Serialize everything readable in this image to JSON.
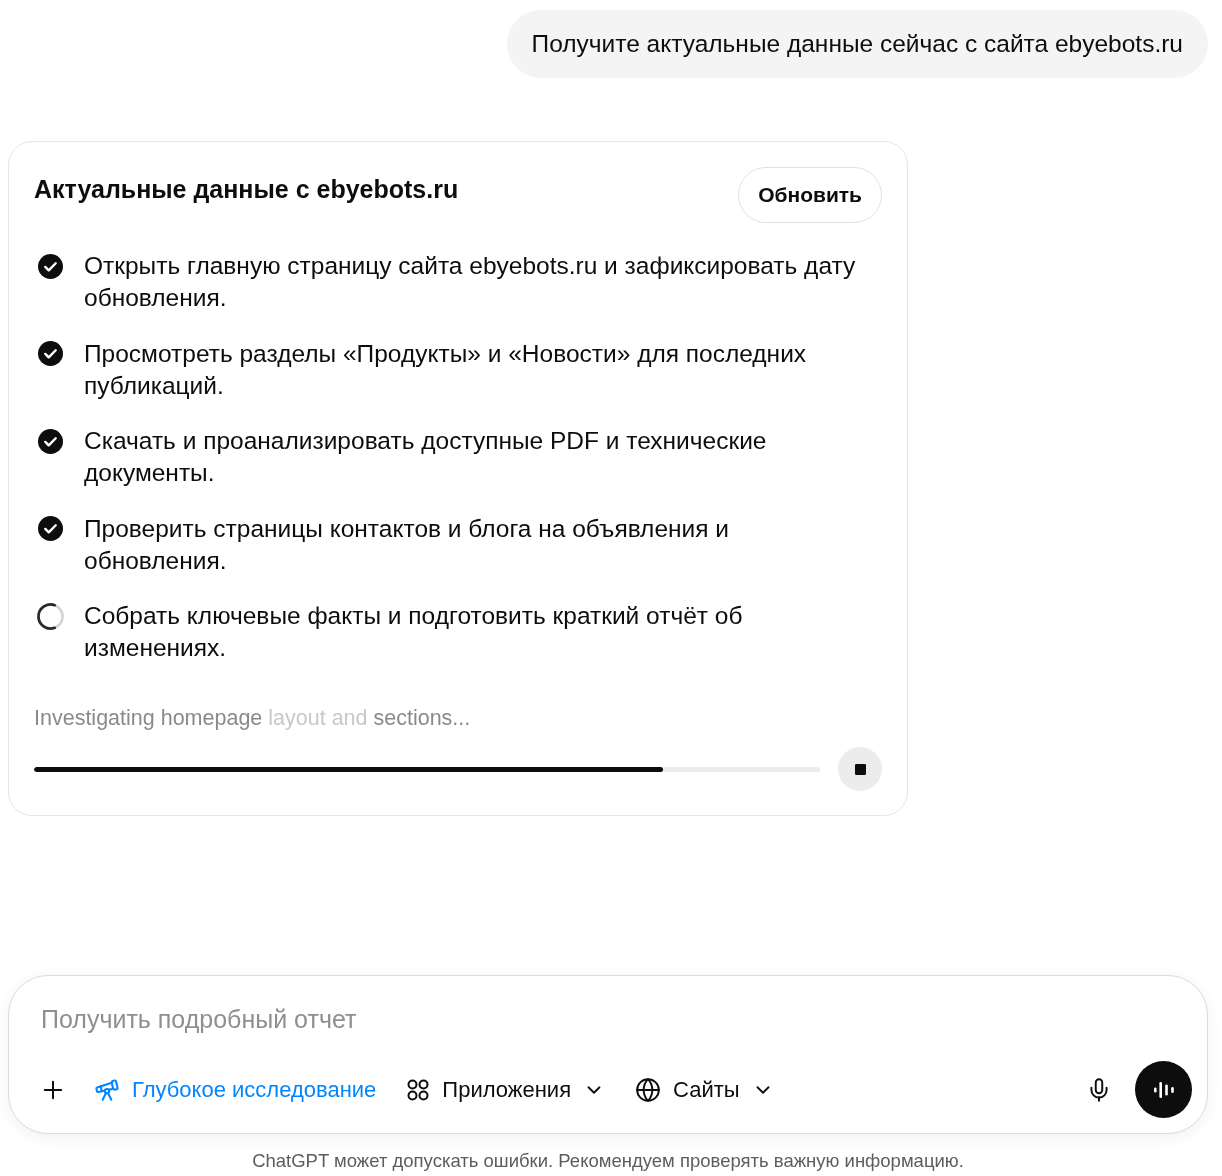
{
  "user_message": {
    "text": "Получите актуальные данные сейчас с сайта ebyebots.ru"
  },
  "task_card": {
    "title": "Актуальные данные с ebyebots.ru",
    "refresh_button": "Обновить",
    "steps": [
      {
        "text": "Открыть главную страницу сайта ebyebots.ru и зафиксировать дату обновления.",
        "checked": true
      },
      {
        "text": "Просмотреть разделы «Продукты» и «Новости» для последних публикаций.",
        "checked": true
      },
      {
        "text": "Скачать и проанализировать доступные PDF и технические документы.",
        "checked": true
      },
      {
        "text": "Проверить страницы контактов и блога на объявления и обновления.",
        "checked": true
      },
      {
        "text": "Собрать ключевые факты и подготовить краткий отчёт об изменениях.",
        "checked": false
      }
    ],
    "status": {
      "segments": [
        {
          "text": "Investigating homepage ",
          "faded": false
        },
        {
          "text": "layout and ",
          "faded": true
        },
        {
          "text": "sections...",
          "faded": false
        }
      ]
    },
    "progress": {
      "level": 0.8
    }
  },
  "composer": {
    "placeholder": "Получить подробный отчет",
    "tools": [
      {
        "kind": "research",
        "label": "Глубокое исследование",
        "selected": true,
        "dropdown": false
      },
      {
        "kind": "apps",
        "label": "Приложения",
        "selected": false,
        "dropdown": true
      },
      {
        "kind": "sites",
        "label": "Сайты",
        "selected": false,
        "dropdown": true
      }
    ]
  },
  "footer": {
    "text": "ChatGPT может допускать ошибки. Рекомендуем проверять важную информацию."
  }
}
